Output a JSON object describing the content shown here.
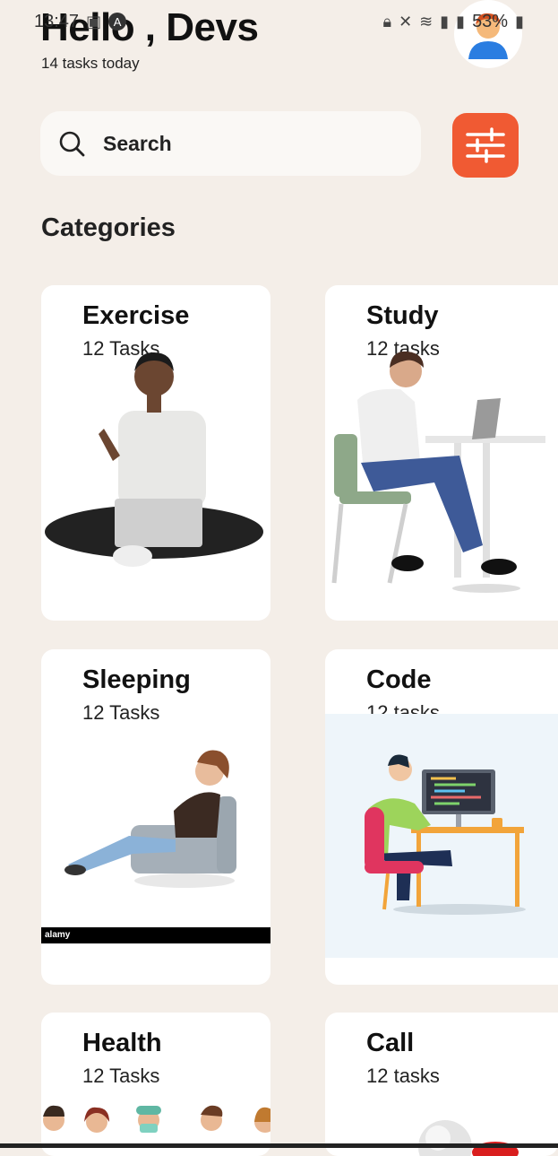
{
  "status_bar": {
    "time": "13:47",
    "battery": "53%",
    "colors": {
      "text": "#333333"
    }
  },
  "header": {
    "greeting": "Hello , Devs",
    "subtitle": "14 tasks today",
    "avatar_icon": "user-avatar-icon"
  },
  "search": {
    "placeholder": "Search",
    "icon": "search-icon"
  },
  "filter_button": {
    "icon": "sliders-icon",
    "color": "#f05a33"
  },
  "categories": {
    "title": "Categories",
    "items": [
      {
        "name": "Exercise",
        "count": "12 Tasks"
      },
      {
        "name": "Study",
        "count": "12 tasks"
      },
      {
        "name": "Sleeping",
        "count": "12 Tasks"
      },
      {
        "name": "Code",
        "count": "12 tasks"
      },
      {
        "name": "Health",
        "count": "12 Tasks"
      },
      {
        "name": "Call",
        "count": "12 tasks"
      }
    ]
  },
  "watermark": {
    "brand": "alamy"
  }
}
